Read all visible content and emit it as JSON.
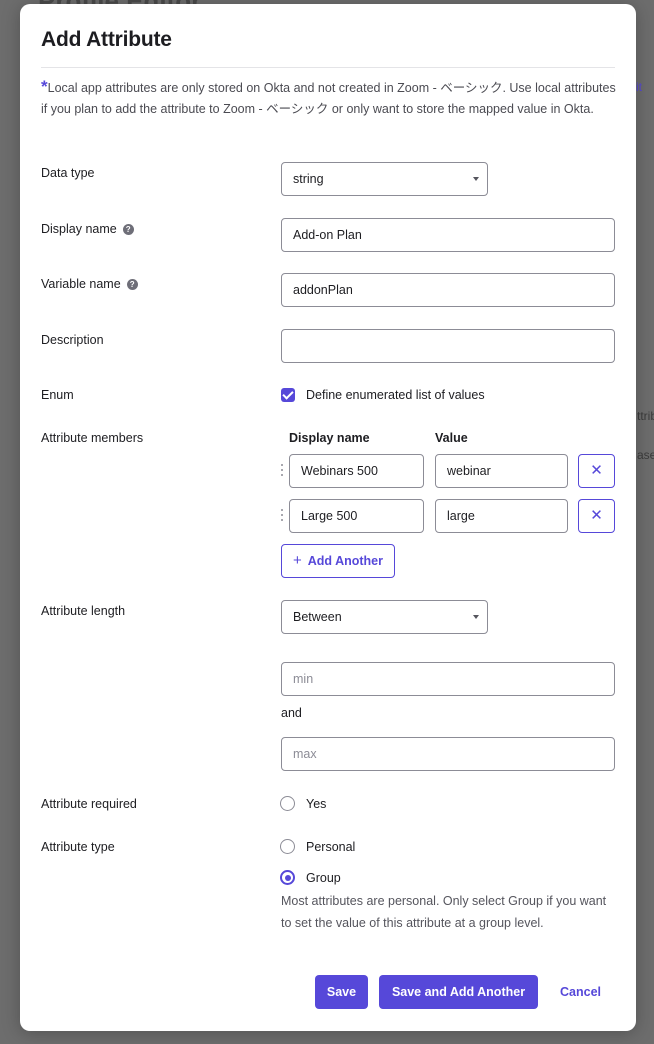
{
  "backdrop": {
    "page_title": "Profile Editor",
    "fragment_right_1": "it",
    "fragment_right_2": "ttrib",
    "fragment_right_3": "ase"
  },
  "modal": {
    "title": "Add Attribute",
    "notice_asterisk": "*",
    "notice": "Local app attributes are only stored on Okta and not created in Zoom - ベーシック. Use local attributes if you plan to add the attribute to Zoom - ベーシック or only want to store the mapped value in Okta."
  },
  "form": {
    "data_type": {
      "label": "Data type",
      "value": "string"
    },
    "display_name": {
      "label": "Display name",
      "value": "Add-on Plan",
      "help_icon": "question-circle-icon"
    },
    "variable_name": {
      "label": "Variable name",
      "value": "addonPlan",
      "help_icon": "question-circle-icon"
    },
    "description": {
      "label": "Description",
      "value": ""
    },
    "enum": {
      "label": "Enum",
      "checkbox_label": "Define enumerated list of values",
      "checked": true
    },
    "attribute_members": {
      "label": "Attribute members",
      "col_display_name": "Display name",
      "col_value": "Value",
      "rows": [
        {
          "display_name": "Webinars 500",
          "value": "webinar",
          "remove_icon": "close-icon"
        },
        {
          "display_name": "Large 500",
          "value": "large",
          "remove_icon": "close-icon"
        }
      ],
      "add_another": "Add Another"
    },
    "attribute_length": {
      "label": "Attribute length",
      "value": "Between",
      "min_placeholder": "min",
      "and_text": "and",
      "max_placeholder": "max"
    },
    "attribute_required": {
      "label": "Attribute required",
      "option": "Yes",
      "selected": false
    },
    "attribute_type": {
      "label": "Attribute type",
      "options": [
        {
          "label": "Personal",
          "selected": false
        },
        {
          "label": "Group",
          "selected": true
        }
      ],
      "hint": "Most attributes are personal. Only select Group if you want to set the value of this attribute at a group level."
    }
  },
  "footer": {
    "save": "Save",
    "save_and_add": "Save and Add Another",
    "cancel": "Cancel"
  },
  "colors": {
    "accent": "#5648d9",
    "overlay": "#6d6d6d"
  }
}
